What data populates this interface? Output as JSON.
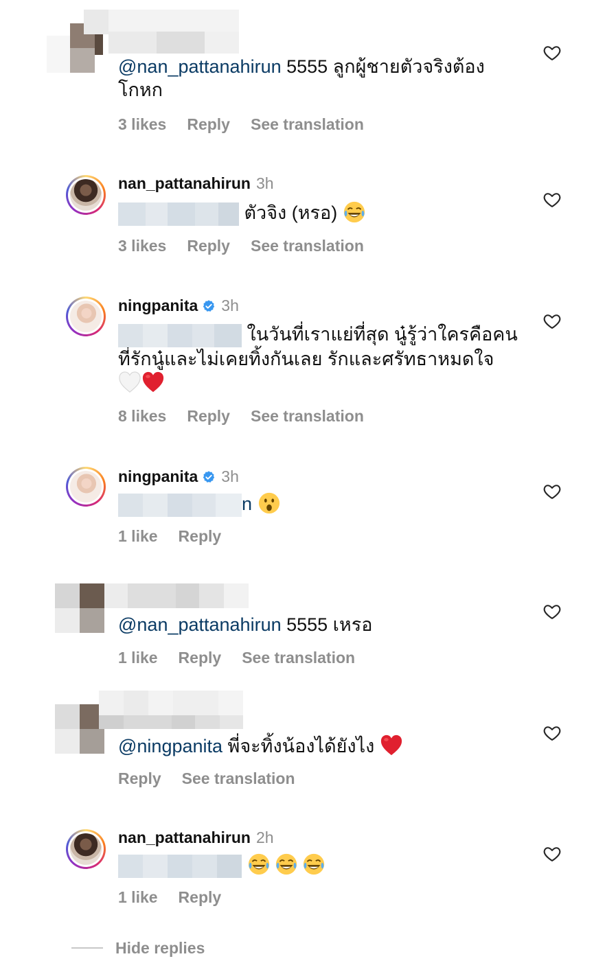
{
  "comments": [
    {
      "username": "",
      "time": "",
      "mention": "@nan_pattanahirun",
      "text_line1": " 5555 ลูกผู้ชายตัวจริงต้อง",
      "text_line2": "โกหก",
      "likes": "3 likes",
      "reply": "Reply",
      "translate": "See translation"
    },
    {
      "username": "nan_pattanahirun",
      "time": "3h",
      "text": "ตัวจิง (หรอ)",
      "likes": "3 likes",
      "reply": "Reply",
      "translate": "See translation"
    },
    {
      "username": "ningpanita",
      "time": "3h",
      "verified": true,
      "text_line1": "ในวันที่เราแย่ที่สุด นู๋รู้ว่าใครคือคน",
      "text_line2": "ที่รักนู๋และไม่เคยทิ้งกันเลย รักและศรัทธาหมดใจ",
      "likes": "8 likes",
      "reply": "Reply",
      "translate": "See translation"
    },
    {
      "username": "ningpanita",
      "time": "3h",
      "verified": true,
      "text_tail": "n",
      "likes": "1 like",
      "reply": "Reply"
    },
    {
      "mention": "@nan_pattanahirun",
      "text": " 5555 เหรอ",
      "likes": "1 like",
      "reply": "Reply",
      "translate": "See translation"
    },
    {
      "mention": "@ningpanita",
      "text": " พี่จะทิ้งน้องได้ยังไง",
      "reply": "Reply",
      "translate": "See translation"
    },
    {
      "username": "nan_pattanahirun",
      "time": "2h",
      "likes": "1 like",
      "reply": "Reply"
    }
  ],
  "footer": {
    "hide_replies": "Hide replies"
  },
  "icons": {
    "heart": "heart-outline-icon",
    "verified": "verified-badge-icon",
    "emoji_laugh": "face-with-tears-of-joy",
    "emoji_surprised": "face-with-open-mouth",
    "emoji_white_heart": "white-heart",
    "emoji_red_heart": "red-heart"
  },
  "colors": {
    "mention": "#0b3b64",
    "secondary": "#8e8e8e",
    "verified": "#3897f0",
    "red_heart": "#e0202f"
  }
}
